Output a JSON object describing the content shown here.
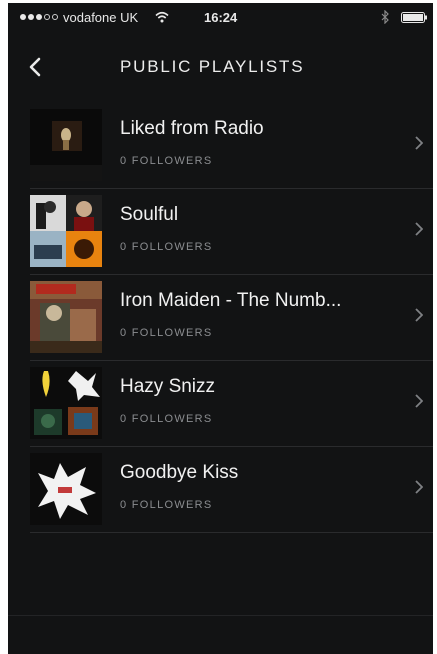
{
  "status_bar": {
    "carrier": "vodafone UK",
    "time": "16:24",
    "signal_bars_filled": 3,
    "signal_bars_total": 5
  },
  "header": {
    "title": "PUBLIC PLAYLISTS",
    "back_icon": "chevron-left-icon"
  },
  "playlists": [
    {
      "title": "Liked from Radio",
      "followers": "0 FOLLOWERS"
    },
    {
      "title": "Soulful",
      "followers": "0 FOLLOWERS"
    },
    {
      "title": "Iron Maiden - The Numb...",
      "followers": "0 FOLLOWERS"
    },
    {
      "title": "Hazy Snizz",
      "followers": "0 FOLLOWERS"
    },
    {
      "title": "Goodbye Kiss",
      "followers": "0 FOLLOWERS"
    }
  ],
  "colors": {
    "background": "#121314",
    "text_primary": "#f1f1f1",
    "text_secondary": "#8b8d90",
    "divider": "#2a2b2d"
  }
}
